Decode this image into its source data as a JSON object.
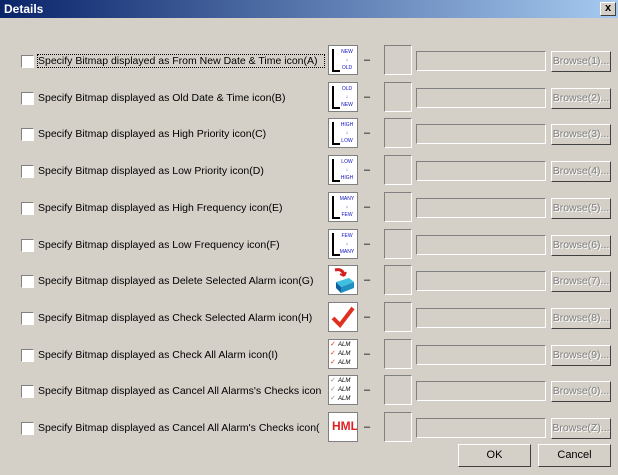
{
  "window": {
    "title": "Details",
    "close_glyph": "x"
  },
  "rows": [
    {
      "label": "Specify Bitmap displayed as From New Date & Time icon(A)",
      "dash": "–",
      "path": "",
      "browse": "Browse(1)...",
      "icon": "new-old-date-icon",
      "icon_text": [
        "NEW",
        "↓",
        "OLD"
      ]
    },
    {
      "label": "Specify Bitmap displayed as Old Date & Time icon(B)",
      "dash": "–",
      "path": "",
      "browse": "Browse(2)...",
      "icon": "old-new-date-icon",
      "icon_text": [
        "OLD",
        "↓",
        "NEW"
      ]
    },
    {
      "label": "Specify Bitmap displayed as High Priority icon(C)",
      "dash": "–",
      "path": "",
      "browse": "Browse(3)...",
      "icon": "high-low-icon",
      "icon_text": [
        "HIGH",
        "↓",
        "LOW"
      ]
    },
    {
      "label": "Specify Bitmap displayed as Low Priority icon(D)",
      "dash": "–",
      "path": "",
      "browse": "Browse(4)...",
      "icon": "low-high-icon",
      "icon_text": [
        "LOW",
        "↓",
        "HIGH"
      ]
    },
    {
      "label": "Specify Bitmap displayed as High Frequency icon(E)",
      "dash": "–",
      "path": "",
      "browse": "Browse(5)...",
      "icon": "many-few-icon",
      "icon_text": [
        "MANY",
        "↓",
        "FEW"
      ]
    },
    {
      "label": "Specify Bitmap displayed as Low Frequency icon(F)",
      "dash": "–",
      "path": "",
      "browse": "Browse(6)...",
      "icon": "few-many-icon",
      "icon_text": [
        "FEW",
        "↓",
        "MANY"
      ]
    },
    {
      "label": "Specify Bitmap displayed as Delete Selected Alarm icon(G)",
      "dash": "–",
      "path": "",
      "browse": "Browse(7)...",
      "icon": "delete-box-icon",
      "icon_text": []
    },
    {
      "label": "Specify Bitmap displayed as Check Selected Alarm icon(H)",
      "dash": "–",
      "path": "",
      "browse": "Browse(8)...",
      "icon": "checkmark-icon",
      "icon_text": []
    },
    {
      "label": "Specify Bitmap displayed as Check All Alarm icon(I)",
      "dash": "–",
      "path": "",
      "browse": "Browse(9)...",
      "icon": "check-all-alarms-icon",
      "icon_text": [
        "ALM",
        "ALM",
        "ALM"
      ]
    },
    {
      "label": "Specify Bitmap displayed as Cancel All Alarms's Checks icon",
      "dash": "–",
      "path": "",
      "browse": "Browse(0)...",
      "icon": "cancel-all-checks-icon",
      "icon_text": [
        "ALM",
        "ALM",
        "ALM"
      ]
    },
    {
      "label": "Specify Bitmap displayed as Cancel All Alarm's Checks icon(",
      "dash": "–",
      "path": "",
      "browse": "Browse(Z)...",
      "icon": "hml-icon",
      "icon_text": [
        "HML"
      ]
    }
  ],
  "buttons": {
    "ok": "OK",
    "cancel": "Cancel"
  },
  "colors": {
    "face": "#d4d0c8",
    "title_start": "#0a246a",
    "title_end": "#a6caf0",
    "disabled_text": "#808080"
  }
}
